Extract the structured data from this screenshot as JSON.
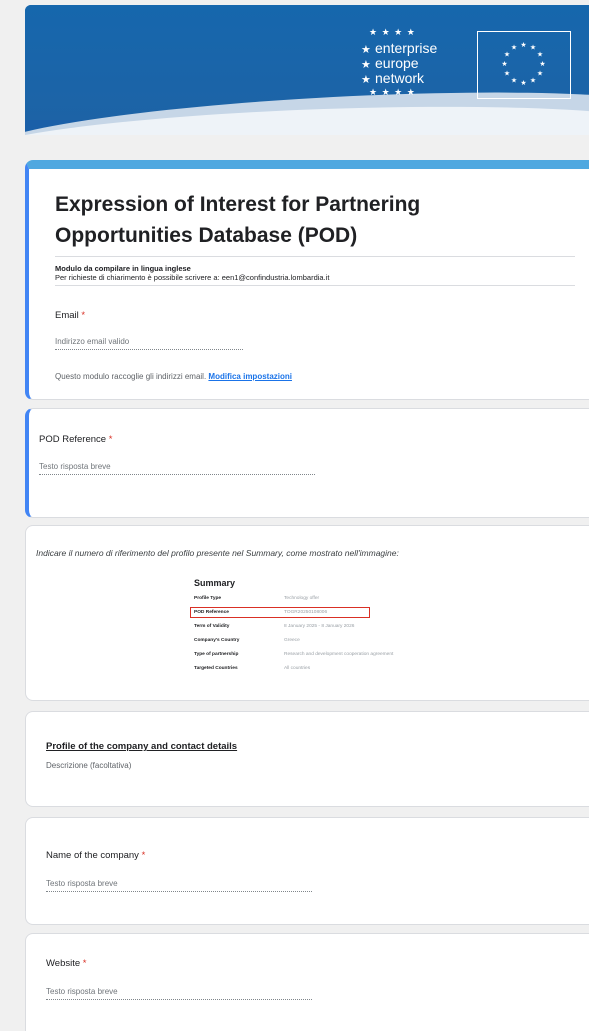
{
  "banner": {
    "logo_lines": [
      "enterprise",
      "europe",
      "network"
    ]
  },
  "form": {
    "title": "Expression of Interest for Partnering Opportunities Database (POD)",
    "description_line1": "Modulo da compilare in lingua inglese",
    "description_line2": "Per richieste di chiarimento è possibile scrivere a: een1@confindustria.lombardia.it"
  },
  "email_question": {
    "label": "Email",
    "required_mark": "*",
    "placeholder": "Indirizzo email valido",
    "note": "Questo modulo raccoglie gli indirizzi email.",
    "settings_link": "Modifica impostazioni"
  },
  "pod_reference": {
    "label": "POD Reference",
    "required_mark": "*",
    "placeholder": "Testo risposta breve"
  },
  "instruction": {
    "text": "Indicare il numero di riferimento del profilo presente nel Summary, come mostrato nell'immagine:",
    "summary": {
      "title": "Summary",
      "rows": [
        {
          "key": "Profile Type",
          "value": "Technology offer"
        },
        {
          "key": "POD Reference",
          "value": "TOGR20250108006"
        },
        {
          "key": "Term of Validity",
          "value": "8 January 2025 - 8 January 2026"
        },
        {
          "key": "Company's Country",
          "value": "Greece"
        },
        {
          "key": "Type of partnership",
          "value": "Research and development cooperation agreement"
        },
        {
          "key": "Targeted Countries",
          "value": "All countries"
        }
      ]
    }
  },
  "section": {
    "title": "Profile of the company and contact details",
    "description": "Descrizione (facoltativa)"
  },
  "company_name": {
    "label": "Name of the company",
    "required_mark": "*",
    "placeholder": "Testo risposta breve"
  },
  "website": {
    "label": "Website",
    "required_mark": "*",
    "placeholder": "Testo risposta breve"
  },
  "colors": {
    "accent": "#4285f4",
    "banner": "#1a5fa8",
    "required": "#d93025",
    "link": "#1a73e8"
  }
}
